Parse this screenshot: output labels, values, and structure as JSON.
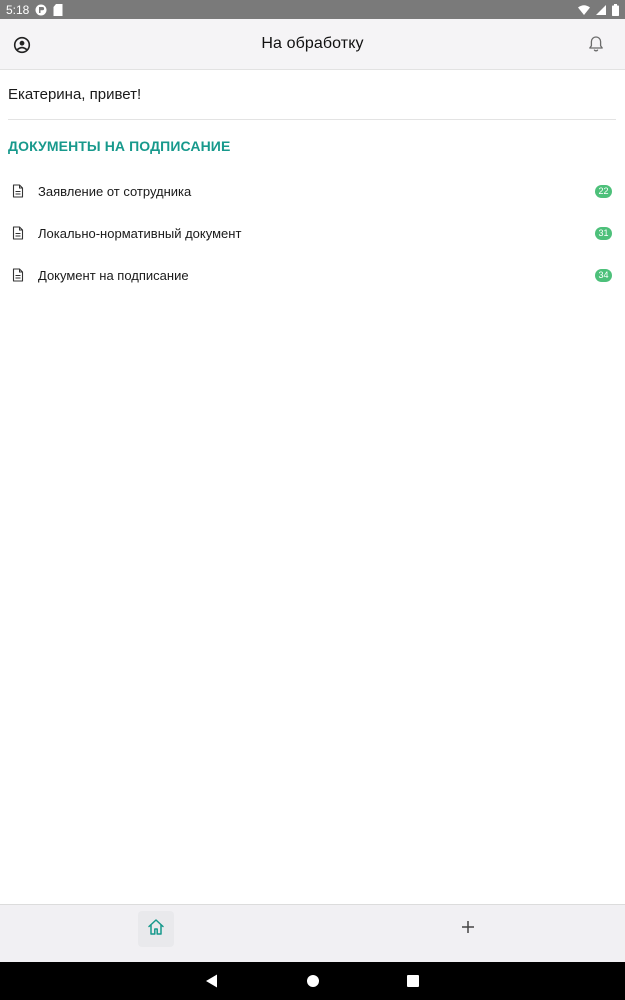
{
  "status_bar": {
    "time": "5:18"
  },
  "app_bar": {
    "title": "На обработку",
    "left_icon": "account-circle-icon",
    "right_icon": "bell-icon"
  },
  "greeting": "Екатерина, привет!",
  "section": {
    "title": "ДОКУМЕНТЫ НА ПОДПИСАНИЕ",
    "items": [
      {
        "label": "Заявление от сотрудника",
        "count": "22",
        "icon": "document-icon"
      },
      {
        "label": "Локально-нормативный документ",
        "count": "31",
        "icon": "document-icon"
      },
      {
        "label": "Документ на подписание",
        "count": "34",
        "icon": "document-icon"
      }
    ]
  },
  "bottom_nav": {
    "items": [
      {
        "icon": "home-icon",
        "active": true
      },
      {
        "icon": "plus-icon",
        "active": false
      }
    ]
  },
  "colors": {
    "accent": "#17998c",
    "badge": "#4dc07a",
    "status_bar": "#7a7a7a",
    "app_bar": "#f5f4f6",
    "bottom_nav": "#f1f0f3"
  }
}
